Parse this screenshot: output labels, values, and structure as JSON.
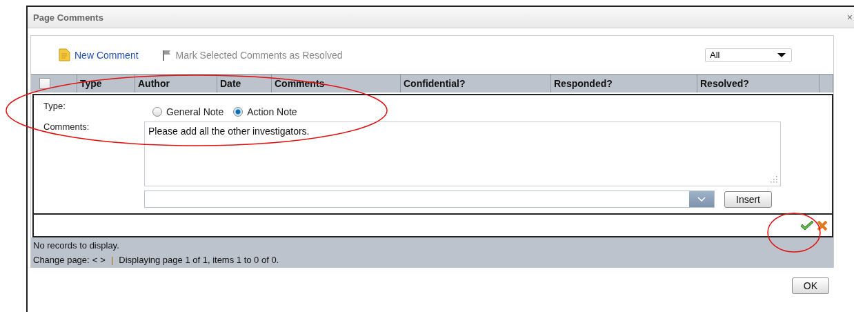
{
  "window": {
    "title": "Page Comments",
    "close": "×"
  },
  "toolbar": {
    "new_comment": "New Comment",
    "mark_resolved": "Mark Selected Comments as Resolved",
    "filter": "All"
  },
  "table": {
    "select_all_checked": false,
    "columns": [
      "Type",
      "Author",
      "Date",
      "Comments",
      "Confidential?",
      "Responded?",
      "Resolved?"
    ]
  },
  "editor": {
    "type_label": "Type:",
    "type_options": [
      {
        "label": "General Note",
        "selected": false
      },
      {
        "label": "Action Note",
        "selected": true
      }
    ],
    "comments_label": "Comments:",
    "comments_value": "Please add all the other investigators.",
    "insert": "Insert"
  },
  "footer": {
    "empty": "No records to display.",
    "change_page": "Change page:",
    "prev": "<",
    "next": ">",
    "separator": "|",
    "summary": "Displaying page 1 of 1, items 1 to 0 of 0."
  },
  "ok": "OK"
}
